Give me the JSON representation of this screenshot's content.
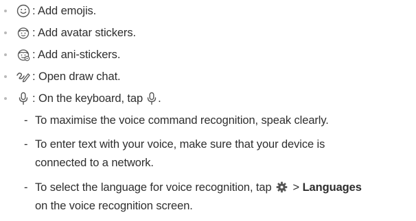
{
  "items": [
    {
      "icon": "smiley-face-icon",
      "text": ": Add emojis."
    },
    {
      "icon": "avatar-sticker-icon",
      "text": ": Add avatar stickers."
    },
    {
      "icon": "ani-sticker-icon",
      "text": ": Add ani-stickers."
    },
    {
      "icon": "draw-chat-icon",
      "text": ": Open draw chat."
    },
    {
      "icon": "microphone-icon",
      "text": ": On the keyboard, tap",
      "suffix": "."
    }
  ],
  "subitems": [
    {
      "text": "To maximise the voice command recognition, speak clearly."
    },
    {
      "line1": "To enter text with your voice, make sure that your device is",
      "line2": "connected to a network."
    },
    {
      "before": "To select the language for voice recognition, tap",
      "gt": ">",
      "bold": "Languages",
      "line2": "on the voice recognition screen."
    }
  ],
  "dash": "-",
  "colors": {
    "text": "#2e2e2e",
    "bullet": "#b9b9b9",
    "icon": "#555555"
  }
}
